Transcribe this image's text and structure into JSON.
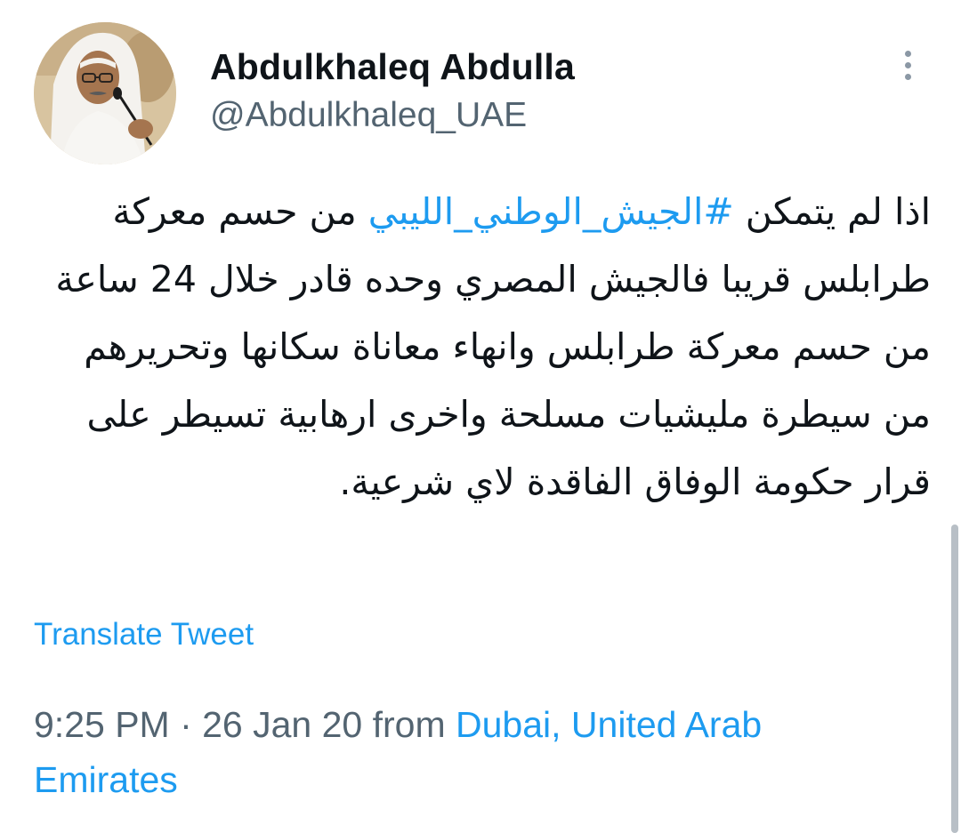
{
  "author": {
    "name": "Abdulkhaleq Abdulla",
    "handle": "@Abdulkhaleq_UAE",
    "avatar_icon": "profile-photo"
  },
  "more_icon": "more-options-icon",
  "tweet": {
    "text_before": "اذا لم يتمكن ",
    "hashtag": "#الجيش_الوطني_الليبي",
    "text_after": " من حسم معركة طرابلس قريبا فالجيش المصري وحده قادر خلال 24 ساعة من حسم معركة طرابلس وانهاء معاناة سكانها وتحريرهم من سيطرة مليشيات مسلحة واخرى ارهابية تسيطر على قرار حكومة الوفاق الفاقدة لاي شرعية."
  },
  "translate_label": "Translate Tweet",
  "meta": {
    "time_date": "9:25 PM · 26 Jan 20 from ",
    "location": "Dubai, United Arab Emirates"
  },
  "colors": {
    "link": "#1d9bf0",
    "secondary_text": "#536471",
    "primary_text": "#0f1419"
  }
}
